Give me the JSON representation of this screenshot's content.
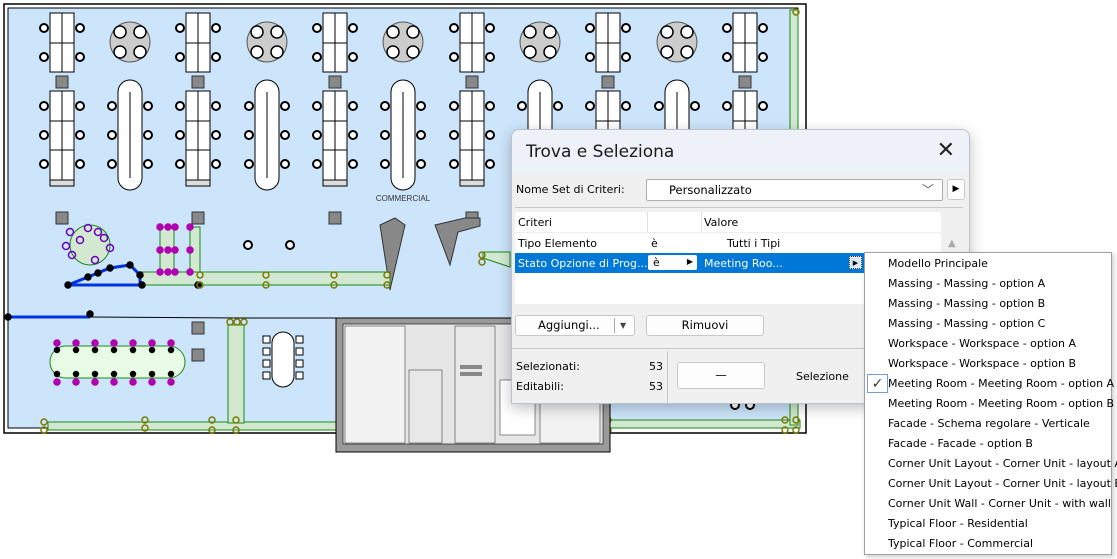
{
  "plan": {
    "room_label": "COMMERCIAL",
    "colors": {
      "floor": "#cce5fb",
      "selection_green": "#d2e8d0",
      "selection_line": "#1a8a1a",
      "handle_magenta": "#b000b0",
      "handle_olive": "#7a7a00",
      "wall_blue": "#0033dd",
      "core_gray": "#9a9a9a"
    }
  },
  "dialog": {
    "title": "Trova e Seleziona",
    "close_icon": "close-icon",
    "criteria_set_label": "Nome Set di Criteri:",
    "criteria_set_value": "Personalizzato",
    "table": {
      "headers": [
        "Criteri",
        "",
        "Valore"
      ],
      "rows": [
        {
          "criterion": "Tipo Elemento",
          "operator": "è",
          "value": "Tutti i Tipi"
        },
        {
          "criterion": "Stato Opzione di Prog...",
          "operator": "è",
          "value": "Meeting Roo..."
        }
      ]
    },
    "add_button": "Aggiungi...",
    "remove_button": "Rimuovi",
    "selected_label": "Selezionati:",
    "selected_count": "53",
    "editable_label": "Editabili:",
    "editable_count": "53",
    "minus_button": "—",
    "selection_label": "Selezione",
    "accent": "#0078d7"
  },
  "popup": {
    "items": [
      "Modello Principale",
      "Massing - Massing - option A",
      "Massing - Massing - option B",
      "Massing - Massing - option C",
      "Workspace - Workspace - option A",
      "Workspace - Workspace - option B",
      "Meeting Room - Meeting Room - option A",
      "Meeting Room - Meeting Room - option B",
      "Facade - Schema regolare - Verticale",
      "Facade - Facade - option B",
      "Corner Unit Layout - Corner Unit - layout A",
      "Corner Unit Layout - Corner Unit - layout B",
      "Corner Unit Wall - Corner Unit - with wall",
      "Typical Floor - Residential",
      "Typical Floor - Commercial"
    ],
    "checked_index": 6
  }
}
